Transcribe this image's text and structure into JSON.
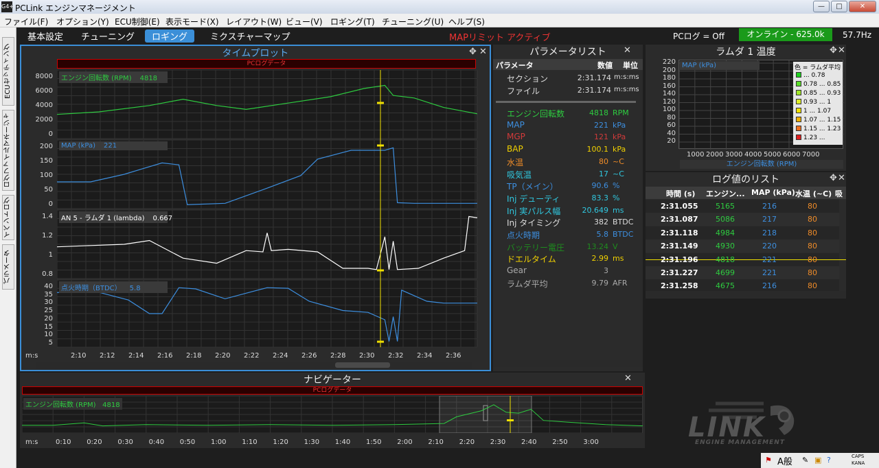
{
  "window": {
    "title": "PCLink エンジンマネージメント",
    "icon": "G4+",
    "min": "—",
    "max": "□",
    "close": "✕"
  },
  "menu": [
    "ファイル(F)",
    "オプション(Y)",
    "ECU制御(E)",
    "表示モード(X)",
    "レイアウト(W)",
    "ビュー(V)",
    "ロギング(T)",
    "チューニング(U)",
    "ヘルプ(S)"
  ],
  "side_tabs": [
    "ECUセッティング",
    "ログファイルマネージャ",
    "イベントログ",
    "パラメータ"
  ],
  "tabs": [
    "基本設定",
    "チューニング",
    "ロギング",
    "ミクスチャーマップ"
  ],
  "status": {
    "map_limit": "MAPリミット アクティブ",
    "pclog": "PCログ = Off",
    "online": "オンライン - 625.0k",
    "rate": "57.7Hz"
  },
  "timeplot": {
    "title": "タイムプロット",
    "band": "PCログデータ",
    "unit_label": "m:s",
    "x_ticks": [
      "2:10",
      "2:12",
      "2:14",
      "2:16",
      "2:18",
      "2:20",
      "2:22",
      "2:24",
      "2:26",
      "2:28",
      "2:30",
      "2:32",
      "2:34",
      "2:36"
    ],
    "segments": [
      {
        "label": "エンジン回転数 (RPM)",
        "value": "4818",
        "color": "#2ecc40",
        "yticks": [
          "8000",
          "6000",
          "4000",
          "2000",
          "0"
        ]
      },
      {
        "label": "MAP (kPa)",
        "value": "221",
        "color": "#3d8fe0",
        "yticks": [
          "200",
          "150",
          "100",
          "50",
          "0"
        ]
      },
      {
        "label": "AN 5 - ラムダ 1 (lambda)",
        "value": "0.667",
        "color": "#ffffff",
        "yticks": [
          "1.4",
          "1.2",
          "1",
          "0.8"
        ]
      },
      {
        "label": "点火時期（BTDC）",
        "value": "5.8",
        "color": "#3d8fe0",
        "yticks": [
          "40",
          "35",
          "30",
          "25",
          "20",
          "15",
          "10",
          "5"
        ]
      }
    ]
  },
  "parameter_list": {
    "title": "パラメータリスト",
    "headers": [
      "パラメータ",
      "数値",
      "単位"
    ],
    "top_rows": [
      {
        "name": "セクション",
        "value": "2:31.174",
        "unit": "m:s:ms"
      },
      {
        "name": "ファイル",
        "value": "2:31.174",
        "unit": "m:s:ms"
      }
    ],
    "rows": [
      {
        "name": "エンジン回転数",
        "value": "4818",
        "unit": "RPM",
        "color": "#2ecc40"
      },
      {
        "name": "MAP",
        "value": "221",
        "unit": "kPa",
        "color": "#3d8fe0"
      },
      {
        "name": "MGP",
        "value": "121",
        "unit": "kPa",
        "color": "#d23a3a"
      },
      {
        "name": "BAP",
        "value": "100.1",
        "unit": "kPa",
        "color": "#f0d000"
      },
      {
        "name": "水温",
        "value": "80",
        "unit": "~C",
        "color": "#f08c28"
      },
      {
        "name": "吸気温",
        "value": "17",
        "unit": "~C",
        "color": "#30c8e0"
      },
      {
        "name": "TP（メイン）",
        "value": "90.6",
        "unit": "%",
        "color": "#3d8fe0"
      },
      {
        "name": "Inj デューティ",
        "value": "83.3",
        "unit": "%",
        "color": "#30c8e0"
      },
      {
        "name": "Inj 実パルス幅",
        "value": "20.649",
        "unit": "ms",
        "color": "#30c8e0"
      },
      {
        "name": "Inj タイミング",
        "value": "382",
        "unit": "BTDC",
        "color": "#dddddd"
      },
      {
        "name": "点火時期",
        "value": "5.8",
        "unit": "BTDC",
        "color": "#3d8fe0"
      },
      {
        "name": "バッテリー電圧",
        "value": "13.24",
        "unit": "V",
        "color": "#1e8c1e"
      },
      {
        "name": "ドエルタイム",
        "value": "2.99",
        "unit": "ms",
        "color": "#f0d000"
      },
      {
        "name": "Gear",
        "value": "3",
        "unit": "",
        "color": "#aaaaaa"
      },
      {
        "name": "ラムダ平均",
        "value": "9.79",
        "unit": "AFR",
        "color": "#aaaaaa"
      }
    ]
  },
  "lambda": {
    "title": "ラムダ 1 温度",
    "series_label": "MAP (kPa)",
    "legend_title": "色 = ラムダ平均",
    "xlabel": "エンジン回転数 (RPM)",
    "yticks": [
      "220",
      "200",
      "180",
      "160",
      "140",
      "120",
      "100",
      "80",
      "60",
      "40",
      "20"
    ],
    "xticks": [
      "1000",
      "2000",
      "3000",
      "4000",
      "5000",
      "6000",
      "7000"
    ],
    "legend": [
      {
        "label": "... 0.78",
        "color": "#1ed01e"
      },
      {
        "label": "0.78 ... 0.85",
        "color": "#5ade28"
      },
      {
        "label": "0.85 ... 0.93",
        "color": "#a0e628"
      },
      {
        "label": "0.93 ... 1",
        "color": "#dcec28"
      },
      {
        "label": "1 ... 1.07",
        "color": "#f0e000"
      },
      {
        "label": "1.07 ... 1.15",
        "color": "#f0b000"
      },
      {
        "label": "1.15 ... 1.23",
        "color": "#f07020"
      },
      {
        "label": "1.23 ...",
        "color": "#e02020"
      }
    ]
  },
  "log_values": {
    "title": "ログ値のリスト",
    "headers": [
      "時間 (s)",
      "エンジン...",
      "MAP (kPa)",
      "水温 (~C)",
      "吸"
    ],
    "rows": [
      [
        "2:31.055",
        "5165",
        "216",
        "80"
      ],
      [
        "2:31.087",
        "5086",
        "217",
        "80"
      ],
      [
        "2:31.118",
        "4984",
        "218",
        "80"
      ],
      [
        "2:31.149",
        "4930",
        "220",
        "80"
      ],
      [
        "2:31.196",
        "4818",
        "221",
        "80"
      ],
      [
        "2:31.227",
        "4699",
        "221",
        "80"
      ],
      [
        "2:31.258",
        "4675",
        "216",
        "80"
      ]
    ]
  },
  "navigator": {
    "title": "ナビゲーター",
    "band": "PCログデータ",
    "label": "エンジン回転数 (RPM)",
    "value": "4818",
    "unit_label": "m:s",
    "x_ticks": [
      "0:10",
      "0:20",
      "0:30",
      "0:40",
      "0:50",
      "1:00",
      "1:10",
      "1:20",
      "1:30",
      "1:40",
      "1:50",
      "2:00",
      "2:10",
      "2:20",
      "2:30",
      "2:40",
      "2:50",
      "3:00"
    ]
  },
  "logo": {
    "brand": "LINK",
    "sub": "ENGINE MANAGEMENT"
  },
  "tray": {
    "ime": "A般",
    "caps": "CAPS",
    "kana": "KANA"
  }
}
